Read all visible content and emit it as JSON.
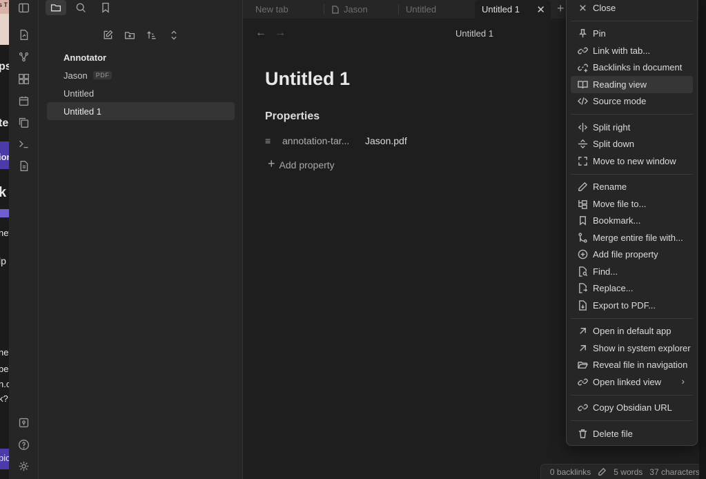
{
  "background_peek": {
    "lines": [
      "s T",
      "ps",
      "ted",
      "ion",
      "k",
      "nev",
      "lp",
      "ne",
      "be",
      "n.c",
      "k?",
      "pic"
    ]
  },
  "tabs": [
    {
      "label": "New tab",
      "icon": ""
    },
    {
      "label": "Jason",
      "icon": "pdf-file-icon"
    },
    {
      "label": "Untitled",
      "icon": ""
    },
    {
      "label": "Untitled 1",
      "icon": "",
      "active": true
    }
  ],
  "tabs_close": "✕",
  "new_tab": "+",
  "file_tree": {
    "folder": "Annotator",
    "items": [
      {
        "label": "Jason",
        "badge": "PDF"
      },
      {
        "label": "Untitled"
      },
      {
        "label": "Untitled 1",
        "selected": true
      }
    ]
  },
  "main": {
    "back": "←",
    "forward": "→",
    "view_title": "Untitled 1",
    "note_title": "Untitled 1",
    "properties_heading": "Properties",
    "property_key": "annotation-tar...",
    "property_value": "Jason.pdf",
    "add_property": "Add property"
  },
  "status_bar": {
    "backlinks": "0 backlinks",
    "words": "5 words",
    "characters": "37 characters"
  },
  "menu": {
    "groups": [
      [
        {
          "label": "Close",
          "icon": "close-icon"
        }
      ],
      [
        {
          "label": "Pin",
          "icon": "pin-icon"
        },
        {
          "label": "Link with tab...",
          "icon": "link-icon"
        },
        {
          "label": "Backlinks in document",
          "icon": "backlinks-icon"
        },
        {
          "label": "Reading view",
          "icon": "book-open-icon",
          "hover": true
        },
        {
          "label": "Source mode",
          "icon": "code-icon"
        }
      ],
      [
        {
          "label": "Split right",
          "icon": "split-right-icon"
        },
        {
          "label": "Split down",
          "icon": "split-down-icon"
        },
        {
          "label": "Move to new window",
          "icon": "maximize-icon"
        }
      ],
      [
        {
          "label": "Rename",
          "icon": "pencil-icon"
        },
        {
          "label": "Move file to...",
          "icon": "folder-tree-icon"
        },
        {
          "label": "Bookmark...",
          "icon": "bookmark-icon"
        },
        {
          "label": "Merge entire file with...",
          "icon": "git-merge-icon"
        },
        {
          "label": "Add file property",
          "icon": "plus-circle-icon"
        },
        {
          "label": "Find...",
          "icon": "file-search-icon"
        },
        {
          "label": "Replace...",
          "icon": "file-replace-icon"
        },
        {
          "label": "Export to PDF...",
          "icon": "file-export-icon"
        }
      ],
      [
        {
          "label": "Open in default app",
          "icon": "arrow-up-right-icon"
        },
        {
          "label": "Show in system explorer",
          "icon": "arrow-up-right-icon"
        },
        {
          "label": "Reveal file in navigation",
          "icon": "folder-open-icon"
        },
        {
          "label": "Open linked view",
          "icon": "link-icon",
          "submenu": true
        }
      ],
      [
        {
          "label": "Copy Obsidian URL",
          "icon": "link-icon"
        }
      ],
      [
        {
          "label": "Delete file",
          "icon": "trash-icon"
        }
      ]
    ]
  }
}
